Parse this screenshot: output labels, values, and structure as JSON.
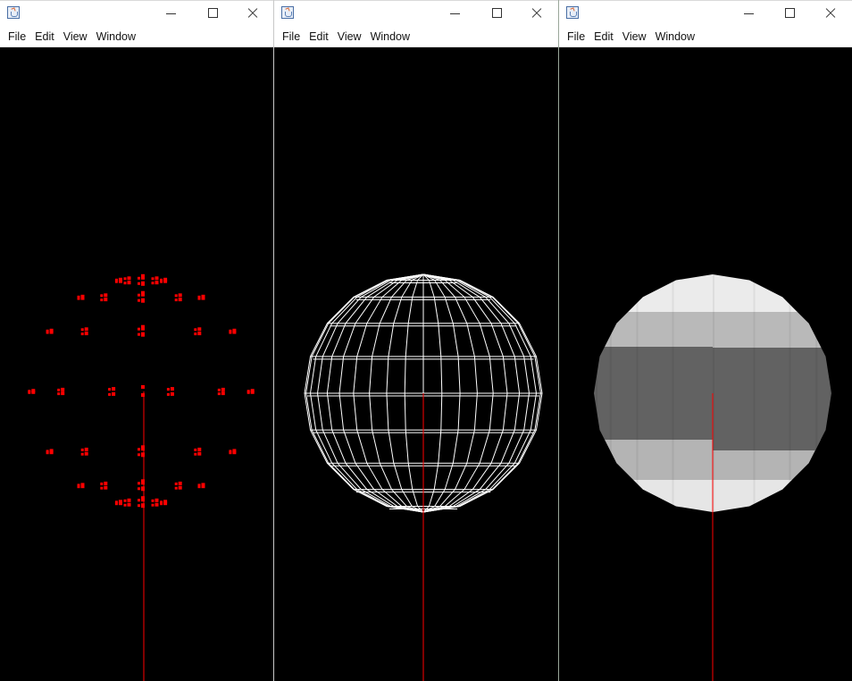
{
  "colors": {
    "canvas_background": "#000000",
    "point_color": "#ff0000",
    "wireframe_color": "#ffffff",
    "axis_color": "#ff0000"
  },
  "windows": [
    {
      "id": "points-window",
      "icon": "java-cup-icon",
      "menu": [
        "File",
        "Edit",
        "View",
        "Window"
      ],
      "render_mode": "points"
    },
    {
      "id": "wireframe-window",
      "icon": "java-cup-icon",
      "menu": [
        "File",
        "Edit",
        "View",
        "Window"
      ],
      "render_mode": "wireframe"
    },
    {
      "id": "solid-window",
      "icon": "java-cup-icon",
      "menu": [
        "File",
        "Edit",
        "View",
        "Window"
      ],
      "render_mode": "shaded"
    }
  ]
}
